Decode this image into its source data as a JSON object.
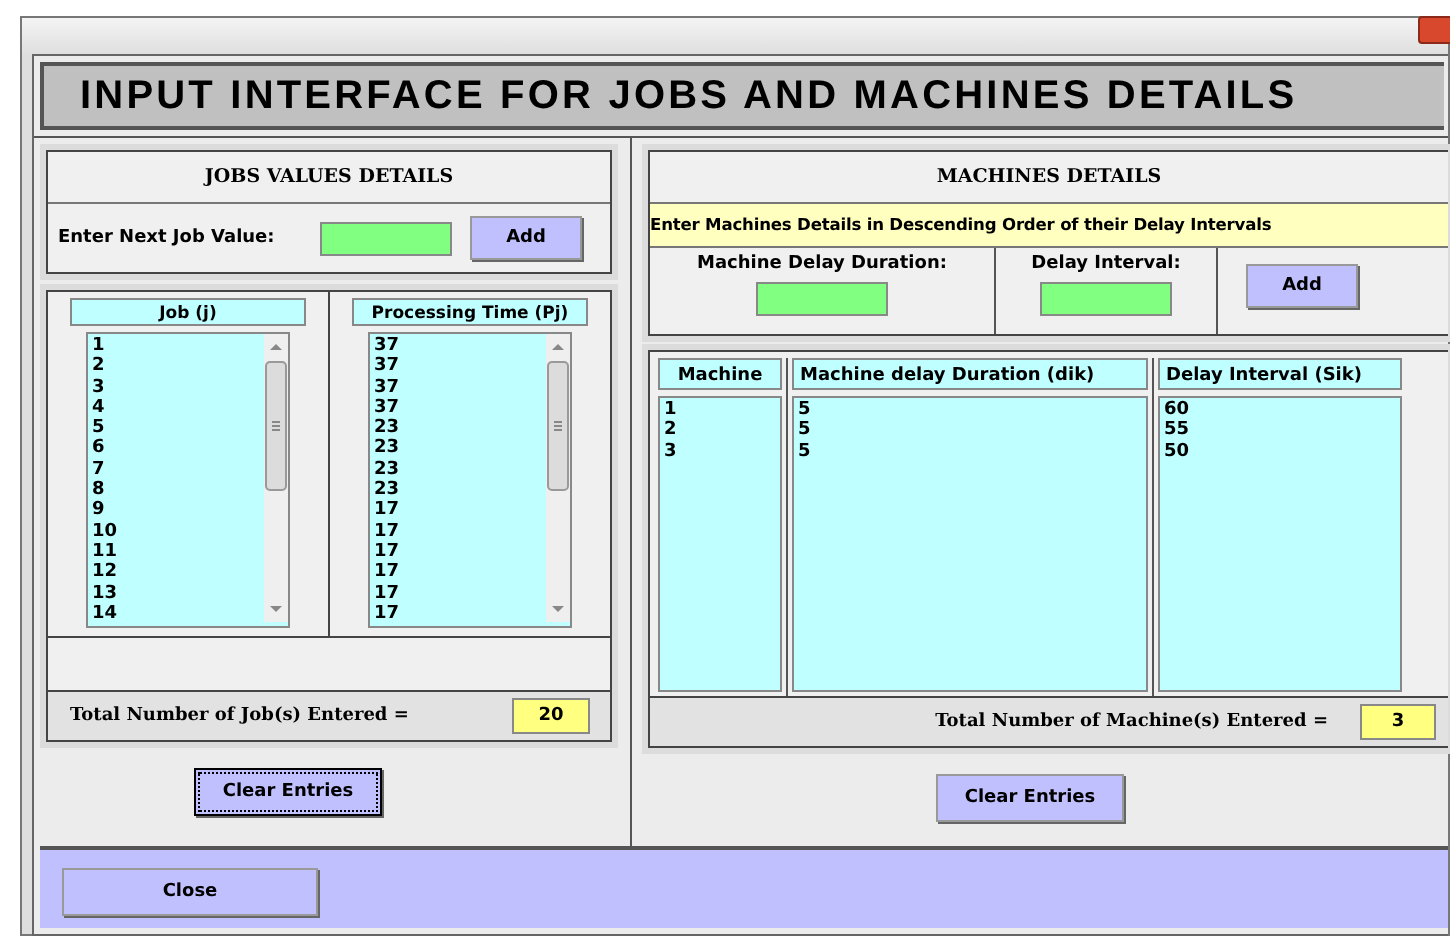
{
  "window": {
    "title": "INPUT INTERFACE FOR JOBS AND MACHINES DETAILS"
  },
  "jobs": {
    "heading": "JOBS VALUES DETAILS",
    "input_label": "Enter Next Job Value:",
    "add_button": "Add",
    "columns": [
      "Job (j)",
      "Processing Time (Pj)"
    ],
    "rows": [
      [
        "1",
        "37"
      ],
      [
        "2",
        "37"
      ],
      [
        "3",
        "37"
      ],
      [
        "4",
        "37"
      ],
      [
        "5",
        "23"
      ],
      [
        "6",
        "23"
      ],
      [
        "7",
        "23"
      ],
      [
        "8",
        "23"
      ],
      [
        "9",
        "17"
      ],
      [
        "10",
        "17"
      ],
      [
        "11",
        "17"
      ],
      [
        "12",
        "17"
      ],
      [
        "13",
        "17"
      ],
      [
        "14",
        "17"
      ]
    ],
    "total_label": "Total Number of Job(s) Entered =",
    "total": "20",
    "clear_button": {
      "label": "Clear Entries",
      "focused": true
    }
  },
  "machines": {
    "heading": "MACHINES DETAILS",
    "notice": "Enter Machines Details in Descending Order of their Delay Intervals",
    "fields": [
      {
        "label": "Machine Delay Duration:"
      },
      {
        "label": "Delay Interval:"
      }
    ],
    "add_button": "Add",
    "columns": [
      "Machine",
      "Machine delay Duration (dik)",
      "Delay Interval (Sik)"
    ],
    "rows": [
      [
        "1",
        "5",
        "60"
      ],
      [
        "2",
        "5",
        "55"
      ],
      [
        "3",
        "5",
        "50"
      ]
    ],
    "total_label": "Total Number of Machine(s) Entered =",
    "total": "3",
    "clear_button": {
      "label": "Clear Entries",
      "focused": false
    }
  },
  "close_button": "Close"
}
